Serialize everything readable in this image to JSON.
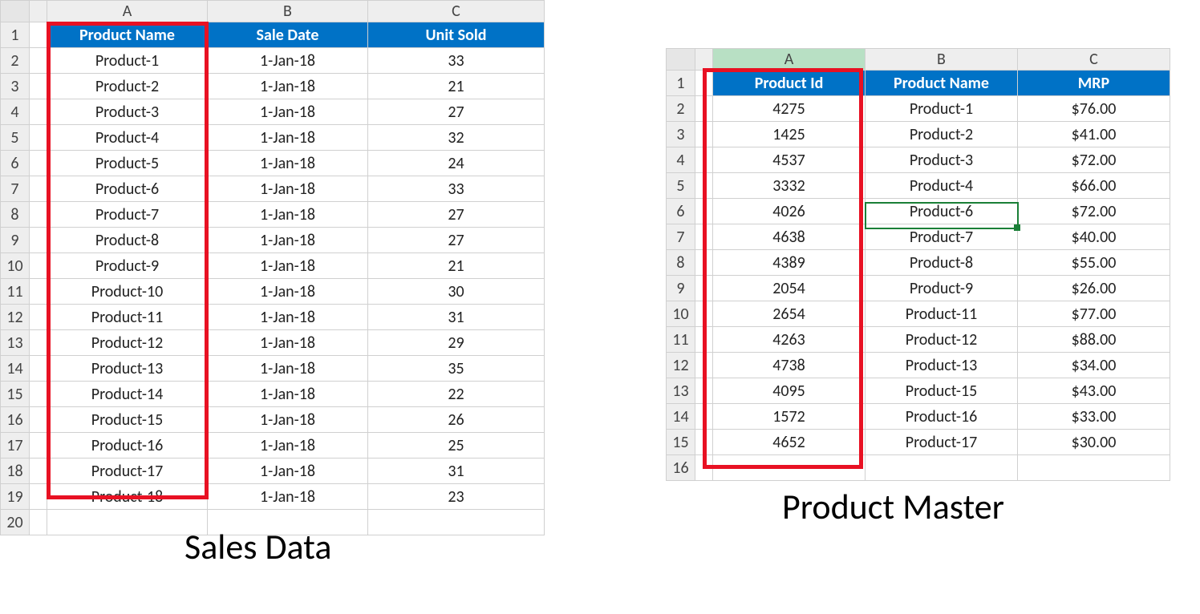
{
  "sales": {
    "cols": [
      "A",
      "B",
      "C"
    ],
    "headers": [
      "Product Name",
      "Sale Date",
      "Unit Sold"
    ],
    "rows": [
      {
        "n": "2",
        "a": "Product-1",
        "b": "1-Jan-18",
        "c": "33"
      },
      {
        "n": "3",
        "a": "Product-2",
        "b": "1-Jan-18",
        "c": "21"
      },
      {
        "n": "4",
        "a": "Product-3",
        "b": "1-Jan-18",
        "c": "27"
      },
      {
        "n": "5",
        "a": "Product-4",
        "b": "1-Jan-18",
        "c": "32"
      },
      {
        "n": "6",
        "a": "Product-5",
        "b": "1-Jan-18",
        "c": "24"
      },
      {
        "n": "7",
        "a": "Product-6",
        "b": "1-Jan-18",
        "c": "33"
      },
      {
        "n": "8",
        "a": "Product-7",
        "b": "1-Jan-18",
        "c": "27"
      },
      {
        "n": "9",
        "a": "Product-8",
        "b": "1-Jan-18",
        "c": "27"
      },
      {
        "n": "10",
        "a": "Product-9",
        "b": "1-Jan-18",
        "c": "21"
      },
      {
        "n": "11",
        "a": "Product-10",
        "b": "1-Jan-18",
        "c": "30"
      },
      {
        "n": "12",
        "a": "Product-11",
        "b": "1-Jan-18",
        "c": "31"
      },
      {
        "n": "13",
        "a": "Product-12",
        "b": "1-Jan-18",
        "c": "29"
      },
      {
        "n": "14",
        "a": "Product-13",
        "b": "1-Jan-18",
        "c": "35"
      },
      {
        "n": "15",
        "a": "Product-14",
        "b": "1-Jan-18",
        "c": "22"
      },
      {
        "n": "16",
        "a": "Product-15",
        "b": "1-Jan-18",
        "c": "26"
      },
      {
        "n": "17",
        "a": "Product-16",
        "b": "1-Jan-18",
        "c": "25"
      },
      {
        "n": "18",
        "a": "Product-17",
        "b": "1-Jan-18",
        "c": "31"
      },
      {
        "n": "19",
        "a": "Product-18",
        "b": "1-Jan-18",
        "c": "23"
      }
    ],
    "caption": "Sales Data"
  },
  "master": {
    "cols": [
      "A",
      "B",
      "C"
    ],
    "headers": [
      "Product Id",
      "Product Name",
      "MRP"
    ],
    "rows": [
      {
        "n": "2",
        "a": "4275",
        "b": "Product-1",
        "c": "$76.00"
      },
      {
        "n": "3",
        "a": "1425",
        "b": "Product-2",
        "c": "$41.00"
      },
      {
        "n": "4",
        "a": "4537",
        "b": "Product-3",
        "c": "$72.00"
      },
      {
        "n": "5",
        "a": "3332",
        "b": "Product-4",
        "c": "$66.00"
      },
      {
        "n": "6",
        "a": "4026",
        "b": "Product-6",
        "c": "$72.00"
      },
      {
        "n": "7",
        "a": "4638",
        "b": "Product-7",
        "c": "$40.00"
      },
      {
        "n": "8",
        "a": "4389",
        "b": "Product-8",
        "c": "$55.00"
      },
      {
        "n": "9",
        "a": "2054",
        "b": "Product-9",
        "c": "$26.00"
      },
      {
        "n": "10",
        "a": "2654",
        "b": "Product-11",
        "c": "$77.00"
      },
      {
        "n": "11",
        "a": "4263",
        "b": "Product-12",
        "c": "$88.00"
      },
      {
        "n": "12",
        "a": "4738",
        "b": "Product-13",
        "c": "$34.00"
      },
      {
        "n": "13",
        "a": "4095",
        "b": "Product-15",
        "c": "$43.00"
      },
      {
        "n": "14",
        "a": "1572",
        "b": "Product-16",
        "c": "$33.00"
      },
      {
        "n": "15",
        "a": "4652",
        "b": "Product-17",
        "c": "$30.00"
      }
    ],
    "caption": "Product Master"
  }
}
